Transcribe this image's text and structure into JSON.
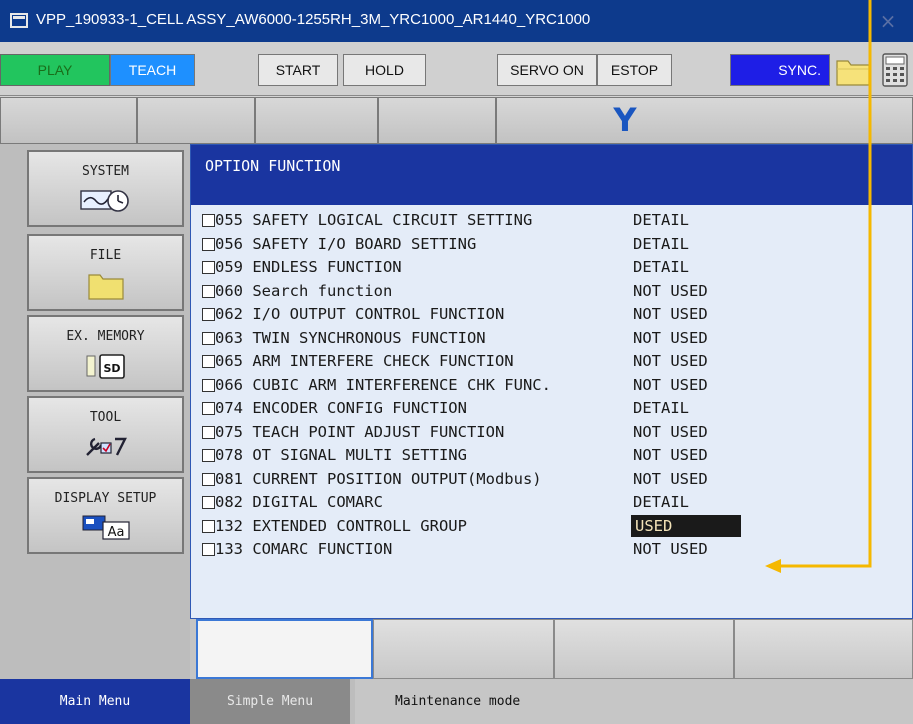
{
  "window": {
    "title": "VPP_190933-1_CELL ASSY_AW6000-1255RH_3M_YRC1000_AR1440_YRC1000",
    "close_glyph": "×"
  },
  "toolbar": {
    "play": "PLAY",
    "teach": "TEACH",
    "start": "START",
    "hold": "HOLD",
    "servo_on": "SERVO ON",
    "estop": "ESTOP",
    "sync": "SYNC."
  },
  "logo": "Y",
  "left_menu": [
    {
      "label": "SYSTEM",
      "icon": "system-clock-icon"
    },
    {
      "label": "FILE",
      "icon": "folder-icon"
    },
    {
      "label": "EX. MEMORY",
      "icon": "sd-card-icon"
    },
    {
      "label": "TOOL",
      "icon": "tools-icon"
    },
    {
      "label": "DISPLAY SETUP",
      "icon": "display-icon"
    }
  ],
  "content": {
    "title": "OPTION FUNCTION",
    "rows": [
      {
        "name": "055 SAFETY LOGICAL CIRCUIT SETTING",
        "status": "DETAIL"
      },
      {
        "name": "056 SAFETY I/O BOARD SETTING",
        "status": "DETAIL"
      },
      {
        "name": "059 ENDLESS FUNCTION",
        "status": "DETAIL"
      },
      {
        "name": "060 Search function",
        "status": "NOT USED"
      },
      {
        "name": "062 I/O OUTPUT CONTROL FUNCTION",
        "status": "NOT USED"
      },
      {
        "name": "063 TWIN SYNCHRONOUS FUNCTION",
        "status": "NOT USED"
      },
      {
        "name": "065 ARM INTERFERE CHECK FUNCTION",
        "status": "NOT USED"
      },
      {
        "name": "066 CUBIC ARM INTERFERENCE CHK FUNC.",
        "status": "NOT USED"
      },
      {
        "name": "074 ENCODER CONFIG FUNCTION",
        "status": "DETAIL"
      },
      {
        "name": "075 TEACH POINT ADJUST FUNCTION",
        "status": "NOT USED"
      },
      {
        "name": "078 OT SIGNAL MULTI SETTING",
        "status": "NOT USED"
      },
      {
        "name": "081 CURRENT POSITION OUTPUT(Modbus)",
        "status": "NOT USED"
      },
      {
        "name": "082 DIGITAL COMARC",
        "status": "DETAIL"
      },
      {
        "name": "132 EXTENDED CONTROLL GROUP",
        "status": "USED"
      },
      {
        "name": "133 COMARC FUNCTION",
        "status": "NOT USED"
      }
    ]
  },
  "status_bar": {
    "main_menu": "Main Menu",
    "simple_menu": "Simple Menu",
    "mode": "Maintenance mode"
  },
  "colors": {
    "annotation": "#f5b800",
    "header_blue": "#1a35a0",
    "play_green": "#22c55e",
    "teach_blue": "#1e90ff"
  }
}
